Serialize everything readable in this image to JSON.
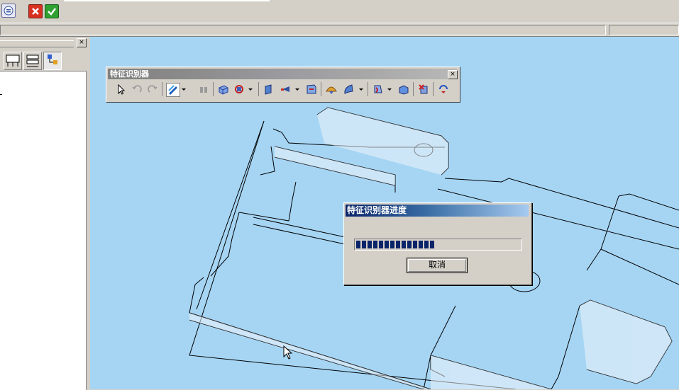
{
  "feature_toolbar": {
    "title": "特征识别器",
    "close_label": "×",
    "icons": [
      "select-icon",
      "undo-icon",
      "redo-icon",
      "recognize-icon",
      "dropdown-arrow-icon",
      "binoculars-icon",
      "face-icon",
      "rotate-icon",
      "dropdown-arrow-icon",
      "plane-icon",
      "pin-icon",
      "dropdown-arrow-icon",
      "chamfer-icon",
      "dome-icon",
      "surface-icon",
      "dropdown-arrow-icon",
      "cut-icon",
      "dropdown-arrow-icon",
      "extrude-icon",
      "delete-feature-icon",
      "refresh-icon"
    ]
  },
  "left_panel": {
    "close_label": "×"
  },
  "progress_dialog": {
    "title": "特征识别器进度",
    "progress": 0.5,
    "cancel_label": "取消"
  },
  "colors": {
    "viewport_bg": "#a6d5f4",
    "progress_fill": "#0a246a"
  }
}
